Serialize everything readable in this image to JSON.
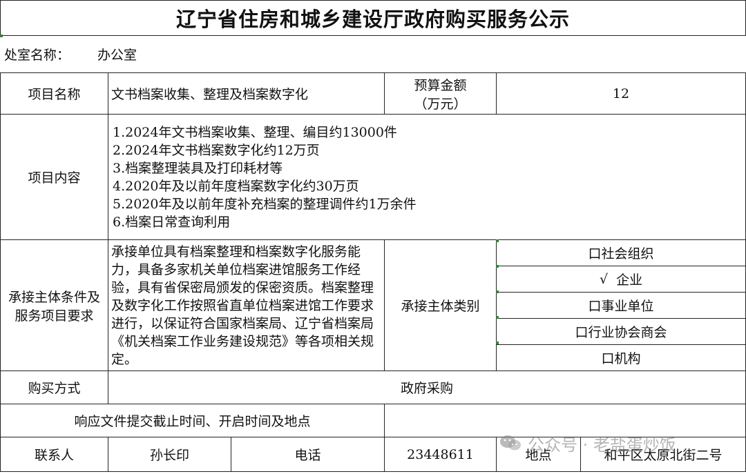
{
  "title": "辽宁省住房和城乡建设厅政府购买服务公示",
  "office": {
    "label": "处室名称：",
    "value": "办公室"
  },
  "project": {
    "name_label": "项目名称",
    "name_value": "文书档案收集、整理及档案数字化",
    "budget_label_line1": "预算金额",
    "budget_label_line2": "（万元）",
    "budget_value": "12"
  },
  "content": {
    "label": "项目内容",
    "items": [
      "1.2024年文书档案收集、整理、编目约13000件",
      "2.2024年文书档案数字化约12万页",
      "3.档案整理装具及打印耗材等",
      "4.2020年及以前年度档案数字化约30万页",
      "5.2020年及以前年度补充档案的整理调件约1万余件",
      "6.档案日常查询利用"
    ]
  },
  "requirements": {
    "label_line1": "承接主体条件及",
    "label_line2": "服务项目要求",
    "text": "承接单位具有档案整理和档案数字化服务能力，具备多家机关单位档案进馆服务工作经验，具有省保密局颁发的保密资质。档案整理及数字化工作按照省直单位档案进馆工作要求进行，以保证符合国家档案局、辽宁省档案局《机关档案工作业务建设规范》等各项相关规定。",
    "category_label": "承接主体类别",
    "options": [
      {
        "text": "口社会组织",
        "checked": false
      },
      {
        "text": "企业",
        "checked": true,
        "mark": "√"
      },
      {
        "text": "口事业单位",
        "checked": false
      },
      {
        "text": "口行业协会商会",
        "checked": false
      },
      {
        "text": "口机构",
        "checked": false
      }
    ]
  },
  "purchase": {
    "label": "购买方式",
    "value": "政府采购"
  },
  "response": {
    "label": "响应文件提交截止时间、开启时间及地点",
    "value": ""
  },
  "contact": {
    "label": "联系人",
    "name": "孙长印",
    "phone_label": "电话",
    "phone": "23448611",
    "address_label": "地点",
    "address": "和平区太原北街二号"
  },
  "watermark": {
    "text": "公众号 · 老盐蛋炒饭",
    "icon": "wechat-icon"
  }
}
